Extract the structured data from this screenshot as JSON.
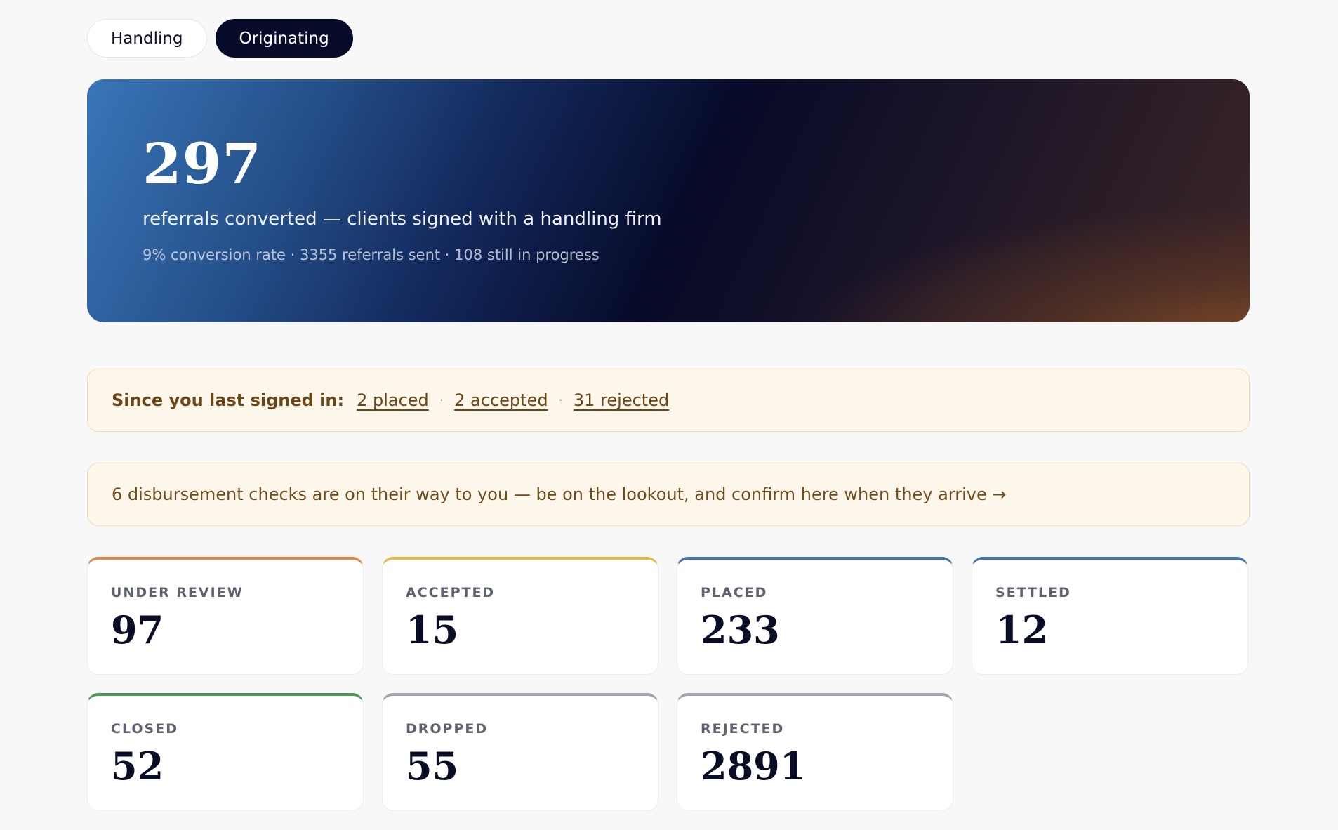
{
  "tabs": [
    {
      "label": "Handling",
      "active": false
    },
    {
      "label": "Originating",
      "active": true
    }
  ],
  "hero": {
    "number": "297",
    "caption": "referrals converted — clients signed with a handling firm",
    "meta": "9% conversion rate · 3355 referrals sent · 108 still in progress"
  },
  "since": {
    "label": "Since you last signed in:",
    "links": [
      "2 placed",
      "2 accepted",
      "31 rejected"
    ],
    "separator": "·"
  },
  "checks_notice": {
    "text": "6 disbursement checks are on their way to you — be on the lookout, and confirm here when they arrive →"
  },
  "cards": [
    {
      "label": "UNDER REVIEW",
      "value": "97",
      "color": "#e08a4e"
    },
    {
      "label": "ACCEPTED",
      "value": "15",
      "color": "#e9b64e"
    },
    {
      "label": "PLACED",
      "value": "233",
      "color": "#3f72ae"
    },
    {
      "label": "SETTLED",
      "value": "12",
      "color": "#3f72ae"
    },
    {
      "label": "CLOSED",
      "value": "52",
      "color": "#4f9a58"
    },
    {
      "label": "DROPPED",
      "value": "55",
      "color": "#a0a3ad"
    },
    {
      "label": "REJECTED",
      "value": "2891",
      "color": "#a0a3ad"
    }
  ]
}
